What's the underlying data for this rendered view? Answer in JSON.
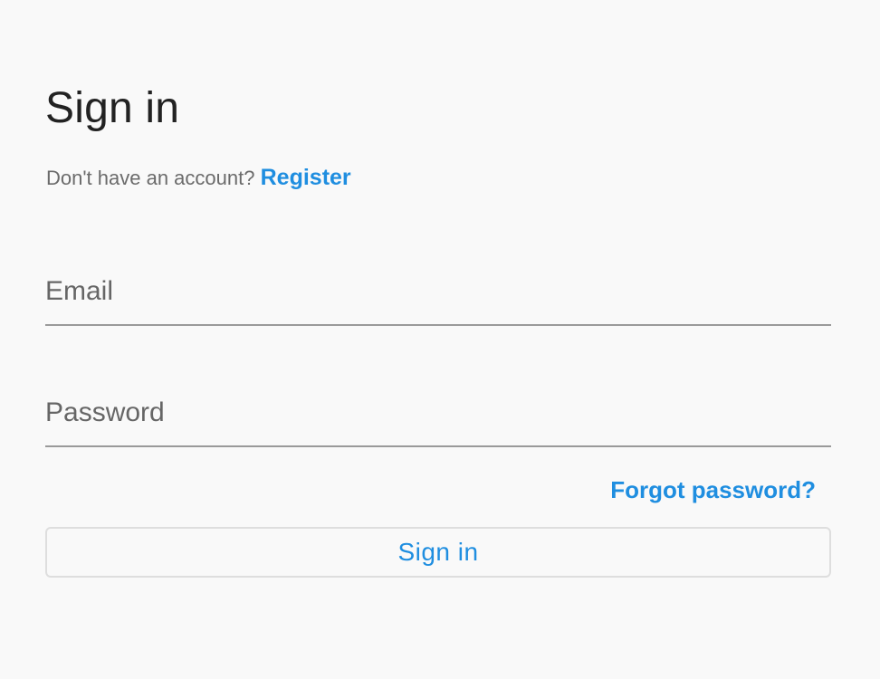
{
  "title": "Sign in",
  "register_prompt": {
    "text": "Don't have an account?",
    "link_label": "Register"
  },
  "form": {
    "email": {
      "placeholder": "Email",
      "value": ""
    },
    "password": {
      "placeholder": "Password",
      "value": ""
    },
    "forgot_label": "Forgot password?",
    "submit_label": "Sign in"
  },
  "colors": {
    "accent": "#1f8ee0",
    "background": "#f9f9f9",
    "title_text": "#222222",
    "muted_text": "#6b6b6b",
    "field_underline": "#9a9a9a",
    "button_border": "#dedede"
  }
}
